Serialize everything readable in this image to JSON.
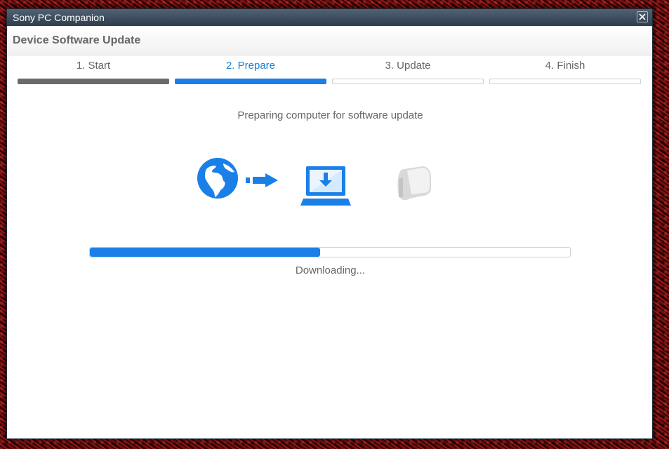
{
  "window": {
    "title": "Sony PC Companion"
  },
  "header": {
    "title": "Device Software Update"
  },
  "steps": [
    {
      "label": "1. Start",
      "state": "done"
    },
    {
      "label": "2. Prepare",
      "state": "active"
    },
    {
      "label": "3. Update",
      "state": "pending"
    },
    {
      "label": "4. Finish",
      "state": "pending"
    }
  ],
  "main": {
    "status": "Preparing computer for software update",
    "icons": [
      "globe-icon",
      "arrow-right-icon",
      "laptop-download-icon",
      "phone-icon"
    ],
    "progress": {
      "percent": 48,
      "label": "Downloading..."
    }
  },
  "colors": {
    "accent": "#1a80e8",
    "done": "#6b6b6b",
    "titlebar": "#3d4d5e"
  }
}
